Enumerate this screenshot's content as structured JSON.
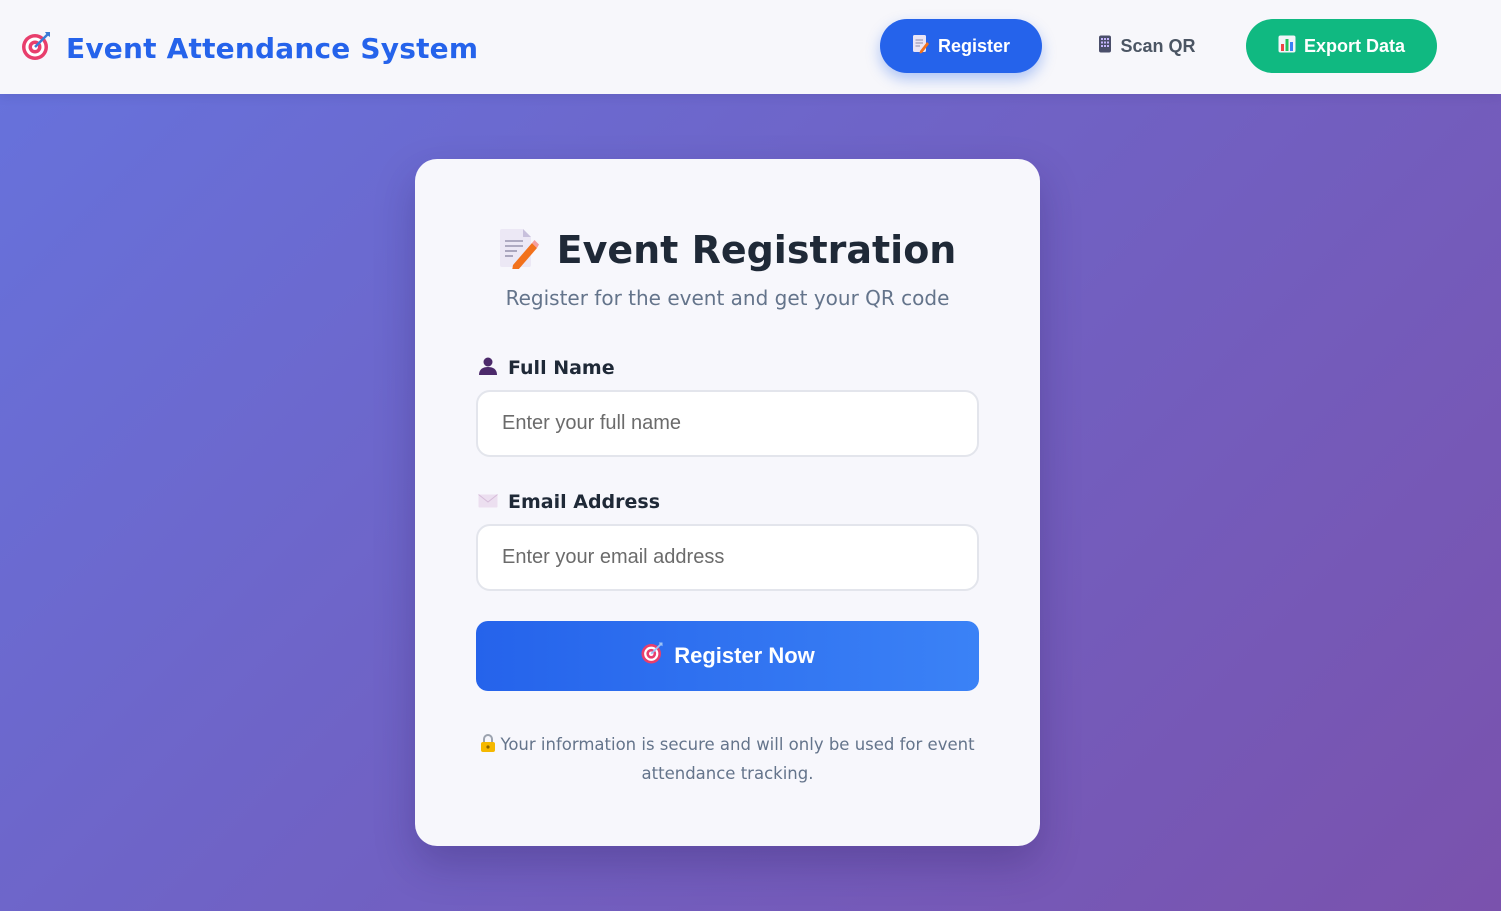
{
  "header": {
    "brand_title": "Event Attendance System",
    "brand_icon": "target-icon",
    "nav": [
      {
        "label": "Register",
        "icon": "memo-icon",
        "active": true,
        "color": "#2563eb"
      },
      {
        "label": "Scan QR",
        "icon": "phone-icon",
        "active": false
      },
      {
        "label": "Export Data",
        "icon": "bar-chart-icon",
        "active": false,
        "color": "#10b981"
      }
    ]
  },
  "form": {
    "title": "Event Registration",
    "title_icon": "memo-icon",
    "subtitle": "Register for the event and get your QR code",
    "full_name": {
      "label": "Full Name",
      "icon": "person-icon",
      "placeholder": "Enter your full name",
      "value": ""
    },
    "email": {
      "label": "Email Address",
      "icon": "envelope-icon",
      "placeholder": "Enter your email address",
      "value": ""
    },
    "submit_label": "Register Now",
    "submit_icon": "target-icon",
    "privacy_note": "Your information is secure and will only be used for event attendance tracking.",
    "privacy_icon": "lock-icon"
  },
  "colors": {
    "accent": "#2563eb",
    "success": "#10b981",
    "background_start": "#6673dd",
    "background_end": "#7a52ad"
  }
}
